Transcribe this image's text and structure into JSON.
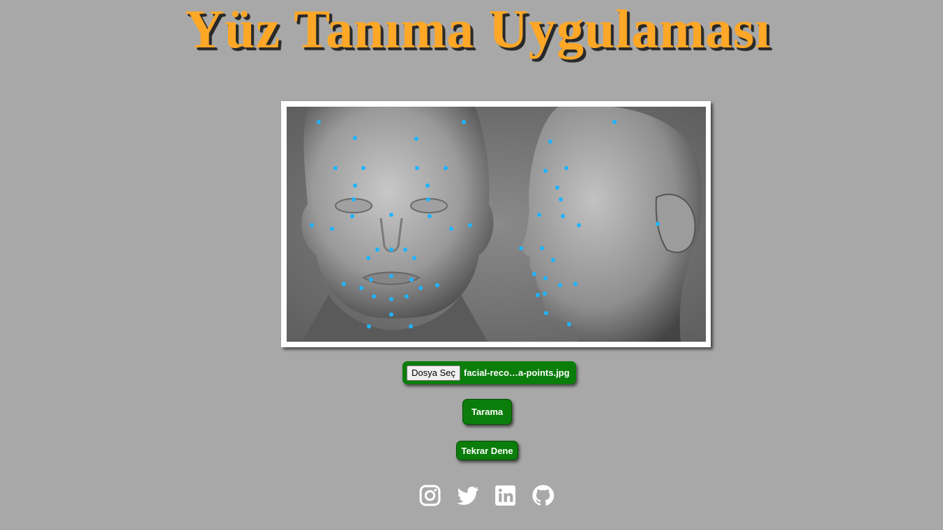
{
  "header": {
    "title": "Yüz Tanıma Uygulaması"
  },
  "image": {
    "alt": "facial recognition points"
  },
  "upload": {
    "button_label": "Dosya Seç",
    "file_name": "facial-reco…a-points.jpg"
  },
  "actions": {
    "scan_label": "Tarama",
    "retry_label": "Tekrar Dene"
  },
  "social": {
    "items": [
      {
        "icon": "instagram-icon"
      },
      {
        "icon": "twitter-icon"
      },
      {
        "icon": "linkedin-icon"
      },
      {
        "icon": "github-icon"
      }
    ]
  },
  "colors": {
    "background": "#a8a8a8",
    "title": "#ffa726",
    "button": "#0b7d0b",
    "landmark": "#1fb4ff"
  }
}
